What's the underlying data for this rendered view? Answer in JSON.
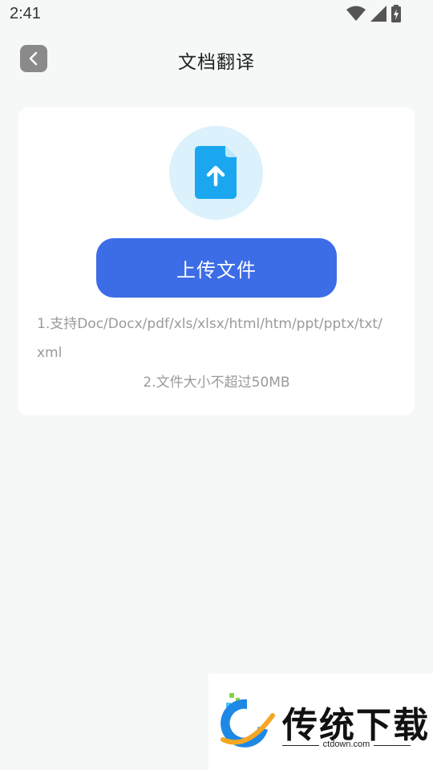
{
  "status_bar": {
    "time": "2:41",
    "icons": [
      "wifi-icon",
      "signal-icon",
      "battery-charging-icon"
    ]
  },
  "header": {
    "title": "文档翻译",
    "back_icon": "chevron-left-icon"
  },
  "upload_card": {
    "icon": "file-upload-icon",
    "button_label": "上传文件",
    "hint_formats": "1.支持Doc/Docx/pdf/xls/xlsx/html/htm/ppt/pptx/txt/xml",
    "hint_size": "2.文件大小不超过50MB"
  },
  "watermark": {
    "name": "传统下载",
    "url": "ctdown.com"
  },
  "colors": {
    "accent": "#3d6ce7",
    "icon_circle": "#dbf1fb",
    "file_icon": "#1aa7f0",
    "background": "#f6f8f8"
  }
}
